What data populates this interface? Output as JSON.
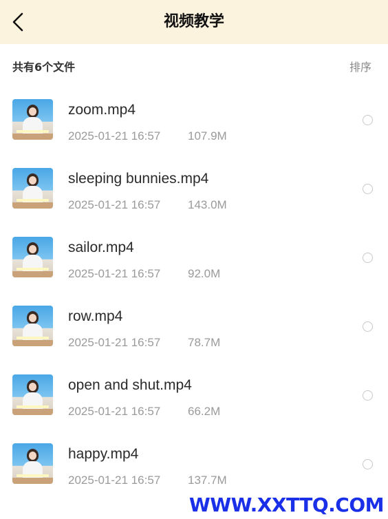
{
  "header": {
    "back_icon": "chevron-left-icon",
    "title": "视频教学",
    "background": "#fcf3df"
  },
  "toolbar": {
    "count_label": "共有6个文件",
    "sort_label": "排序"
  },
  "files": [
    {
      "name": "zoom.mp4",
      "date": "2025-01-21 16:57",
      "size": "107.9M"
    },
    {
      "name": "sleeping bunnies.mp4",
      "date": "2025-01-21 16:57",
      "size": "143.0M"
    },
    {
      "name": "sailor.mp4",
      "date": "2025-01-21 16:57",
      "size": "92.0M"
    },
    {
      "name": "row.mp4",
      "date": "2025-01-21 16:57",
      "size": "78.7M"
    },
    {
      "name": "open and shut.mp4",
      "date": "2025-01-21 16:57",
      "size": "66.2M"
    },
    {
      "name": "happy.mp4",
      "date": "2025-01-21 16:57",
      "size": "137.7M"
    }
  ],
  "watermark": {
    "text": "WWW.XXTTQ.COM",
    "color": "#1a2fe8"
  }
}
